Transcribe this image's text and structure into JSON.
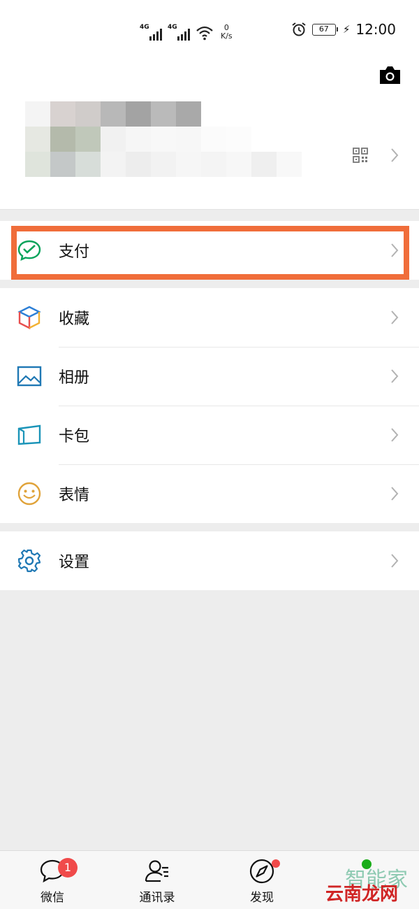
{
  "status_bar": {
    "signal_1_tag": "4G",
    "signal_2_tag": "4G",
    "net_speed_value": "0",
    "net_speed_unit": "K/s",
    "battery": "67",
    "time": "12:00",
    "icons": [
      "alarm-icon",
      "wifi-icon",
      "charging-icon"
    ]
  },
  "profile": {
    "camera_icon": "camera-icon",
    "qr_icon": "qr-code-icon",
    "mosaic_colors": [
      "#f4f4f4",
      "#d8d2d0",
      "#d0ccca",
      "#b8b8b8",
      "#a3a3a3",
      "#bababa",
      "#a9a9a9",
      "#ffffff",
      "#ffffff",
      "#ffffff",
      "#ffffff",
      "#e6e8e2",
      "#b4baab",
      "#c0c8ba",
      "#f1f1f1",
      "#f6f6f6",
      "#f8f8f8",
      "#f7f7f7",
      "#fbfbfb",
      "#fcfcfc",
      "#ffffff",
      "#ffffff",
      "#dfe4dc",
      "#c4c8c8",
      "#d7ddd9",
      "#f3f3f3",
      "#ededed",
      "#f2f2f2",
      "#f6f6f6",
      "#f4f4f4",
      "#f7f7f7",
      "#efefef",
      "#f8f8f8"
    ]
  },
  "menu": {
    "pay": {
      "label": "支付",
      "icon": "wechat-pay-icon",
      "color": "#07a35a"
    },
    "favorites": {
      "label": "收藏",
      "icon": "cube-icon"
    },
    "album": {
      "label": "相册",
      "icon": "picture-icon",
      "color": "#1f78b4"
    },
    "cards": {
      "label": "卡包",
      "icon": "card-wallet-icon",
      "color": "#1a94b8"
    },
    "stickers": {
      "label": "表情",
      "icon": "smiley-icon",
      "color": "#e0a33a"
    },
    "settings": {
      "label": "设置",
      "icon": "gear-icon",
      "color": "#1f78b4"
    }
  },
  "highlight_color": "#f06d3a",
  "tabbar": {
    "chats": {
      "label": "微信",
      "badge": "1"
    },
    "contacts": {
      "label": "通讯录"
    },
    "discover": {
      "label": "发现"
    }
  },
  "watermark": {
    "line1": "智能家",
    "line2": "云南龙网"
  }
}
